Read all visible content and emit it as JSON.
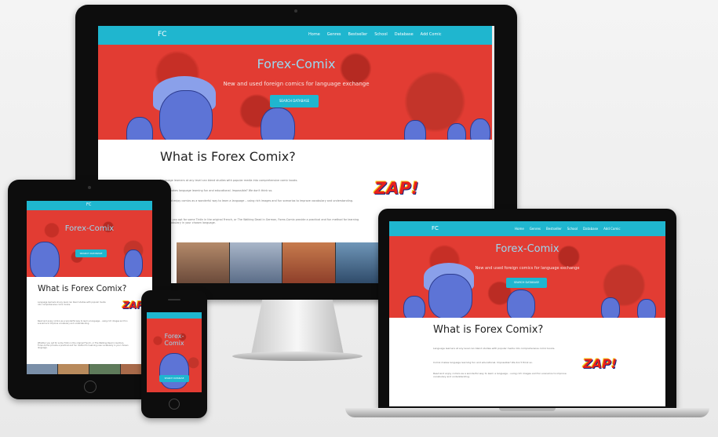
{
  "site": {
    "brand": "FC",
    "title": "Forex-Comix",
    "subtitle": "New and used foreign comics for language exchange",
    "cta": "SEARCH DATABASE",
    "section_heading": "What is Forex Comix?",
    "nav": [
      "Home",
      "Genres",
      "Bestseller",
      "School",
      "Database",
      "Add Comic"
    ],
    "paragraphs": [
      "Language learners at any level can blend studies with popular media into comprehensive comic books.",
      "Comix makes language learning fun and educational. Impossible? We don't think so.",
      "Read and enjoy comics as a wonderful way to learn a language – using rich images and fun scenarios to improve vocabulary and understanding.",
      "Whether you opt for some Tintin in the original French, or The Walking Dead in German, Forex-Comix provide a practical and fun method for learning new vocabulary in your chosen language."
    ],
    "zap": "ZAP!"
  },
  "colors": {
    "nav": "#1fb6cf",
    "hero": "#e23c33",
    "title": "#9ad8f0"
  }
}
